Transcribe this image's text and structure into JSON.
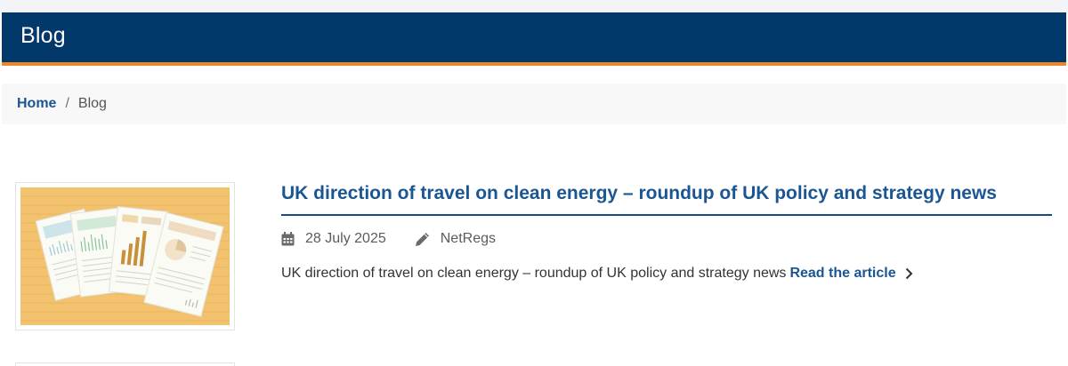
{
  "header": {
    "title": "Blog",
    "background": "#02386a",
    "accent": "#e8872e"
  },
  "breadcrumb": {
    "home_label": "Home",
    "separator": "/",
    "current_label": "Blog"
  },
  "articles": [
    {
      "title": "UK direction of travel on clean energy – roundup of UK policy and strategy news",
      "date": "28 July 2025",
      "author": "NetRegs",
      "summary": "UK direction of travel on clean energy – roundup of UK policy and strategy news",
      "read_more_label": "Read the article",
      "thumbnail": "documents-illustration",
      "date_icon": "calendar-icon",
      "author_icon": "pencil-icon",
      "read_more_icon": "chevron-right-icon"
    }
  ]
}
